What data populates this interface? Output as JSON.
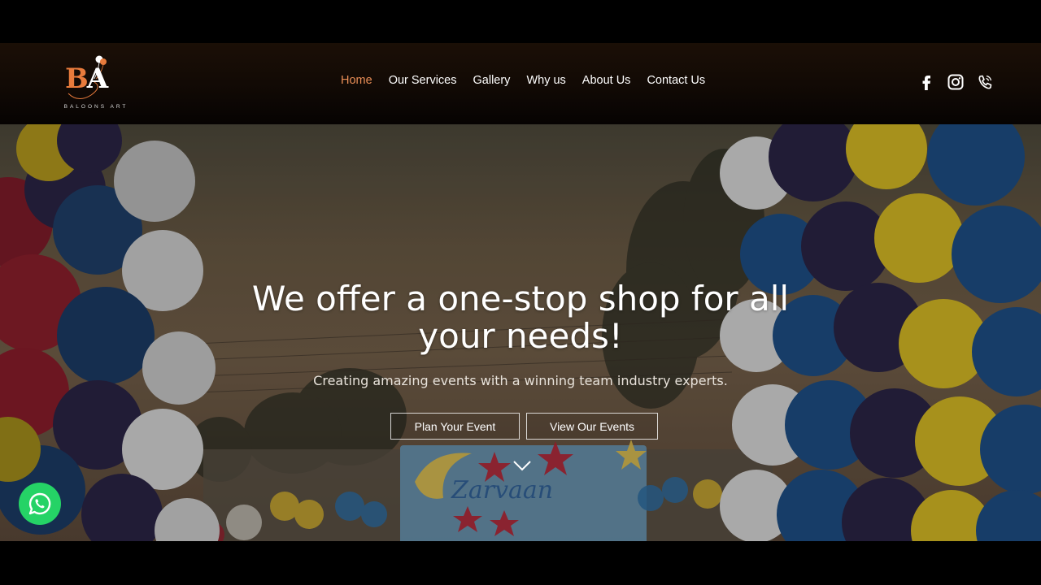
{
  "brand": {
    "logo_caption": "BALOONS ART",
    "accent_color": "#e87b3c"
  },
  "nav": {
    "items": [
      {
        "label": "Home",
        "active": true
      },
      {
        "label": "Our Services",
        "active": false
      },
      {
        "label": "Gallery",
        "active": false
      },
      {
        "label": "Why us",
        "active": false
      },
      {
        "label": "About Us",
        "active": false
      },
      {
        "label": "Contact Us",
        "active": false
      }
    ],
    "active_color": "#e98e57"
  },
  "social": {
    "icons": [
      "facebook-icon",
      "instagram-icon",
      "phone-icon"
    ]
  },
  "hero": {
    "title": "We offer a one-stop shop for all your needs!",
    "subtitle": "Creating amazing events with a winning team industry experts.",
    "primary_button": "Plan Your Event",
    "secondary_button": "View Our Events",
    "scroll_icon": "chevron-down-icon"
  },
  "floating": {
    "whatsapp_icon": "whatsapp-icon",
    "whatsapp_color": "#25d366"
  }
}
